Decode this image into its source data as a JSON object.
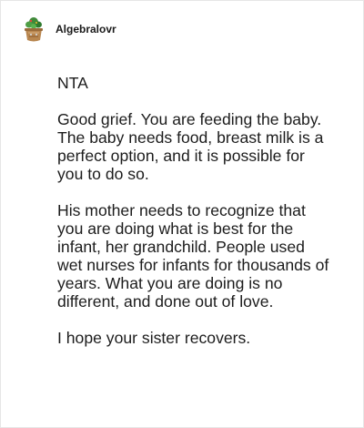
{
  "comment": {
    "author": "Algebralovr",
    "avatar_icon": "plant-pot-avatar",
    "paragraphs": [
      "NTA",
      "Good grief. You are feeding the baby. The baby needs food, breast milk is a perfect option, and it is possible for you to do so.",
      "His mother needs to recognize that you are doing what is best for the infant, her grandchild. People used wet nurses for infants for thousands of years. What you are doing is no different, and done out of love.",
      "I hope your sister recovers."
    ]
  }
}
